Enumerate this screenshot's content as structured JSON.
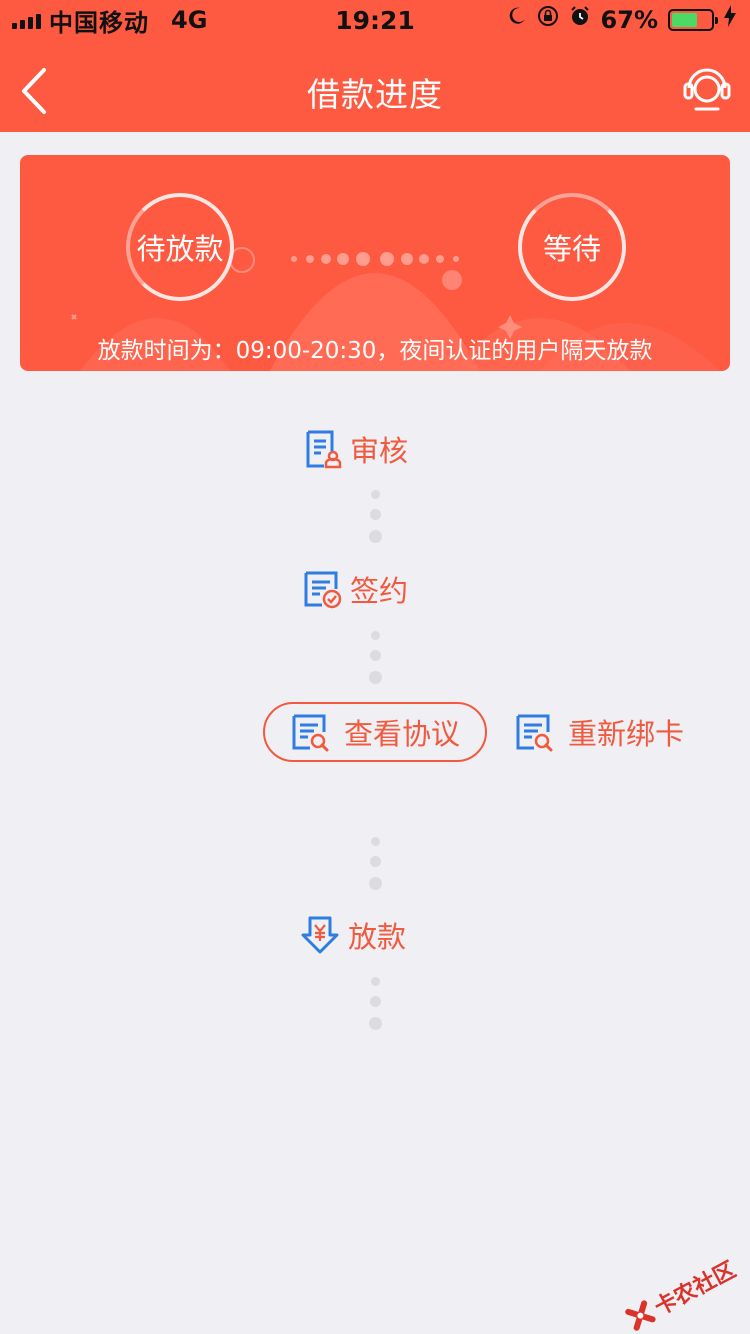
{
  "status_bar": {
    "carrier": "中国移动",
    "network": "4G",
    "time": "19:21",
    "battery_pct": "67%",
    "battery_level": 0.67
  },
  "nav": {
    "title": "借款进度"
  },
  "banner": {
    "current_status": "待放款",
    "next_status": "等待",
    "note": "放款时间为：09:00-20:30，夜间认证的用户隔天放款"
  },
  "steps": {
    "review": "审核",
    "sign": "签约",
    "disburse": "放款"
  },
  "actions": {
    "view_protocol": "查看协议",
    "rebind_card": "重新绑卡"
  },
  "watermark": "卡农社区",
  "colors": {
    "brand": "#fe5941",
    "accent_text": "#f15a3f",
    "icon_blue": "#2f7de0",
    "background": "#efeff4"
  }
}
